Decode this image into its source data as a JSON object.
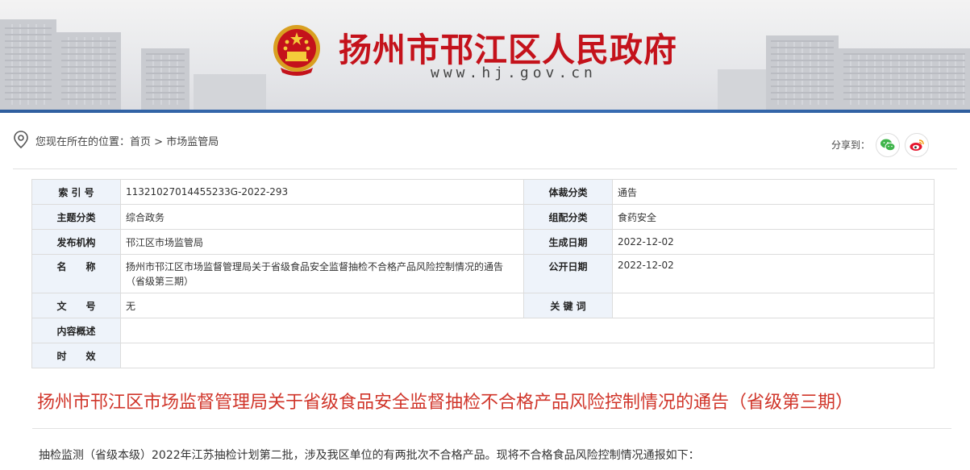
{
  "header": {
    "site_title": "扬州市邗江区人民政府",
    "site_url": "www.hj.gov.cn",
    "accent_color": "#c4121b"
  },
  "breadcrumb": {
    "prefix": "您现在所在的位置：",
    "home": "首页",
    "separator": ">",
    "current": "市场监管局"
  },
  "share": {
    "label": "分享到：",
    "items": [
      "wechat-icon",
      "weibo-icon"
    ]
  },
  "info_table": {
    "rows": [
      {
        "k1": "索 引 号",
        "v1": "11321027014455233G-2022-293",
        "k2": "体裁分类",
        "v2": "通告"
      },
      {
        "k1": "主题分类",
        "v1": "综合政务",
        "k2": "组配分类",
        "v2": "食药安全"
      },
      {
        "k1": "发布机构",
        "v1": "邗江区市场监管局",
        "k2": "生成日期",
        "v2": "2022-12-02"
      },
      {
        "k1": "名　　称",
        "v1": "扬州市邗江区市场监督管理局关于省级食品安全监督抽检不合格产品风险控制情况的通告（省级第三期）",
        "k2": "公开日期",
        "v2": "2022-12-02"
      },
      {
        "k1": "文　　号",
        "v1": "无",
        "k2": "关 键 词",
        "v2": ""
      },
      {
        "k1": "内容概述",
        "v1": ""
      },
      {
        "k1": "时　　效",
        "v1": ""
      }
    ]
  },
  "article": {
    "title": "扬州市邗江区市场监督管理局关于省级食品安全监督抽检不合格产品风险控制情况的通告（省级第三期）",
    "title_color": "#d0352a",
    "body_first_line": "抽检监测（省级本级）2022年江苏抽检计划第二批，涉及我区单位的有两批次不合格产品。现将不合格食品风险控制情况通报如下："
  }
}
